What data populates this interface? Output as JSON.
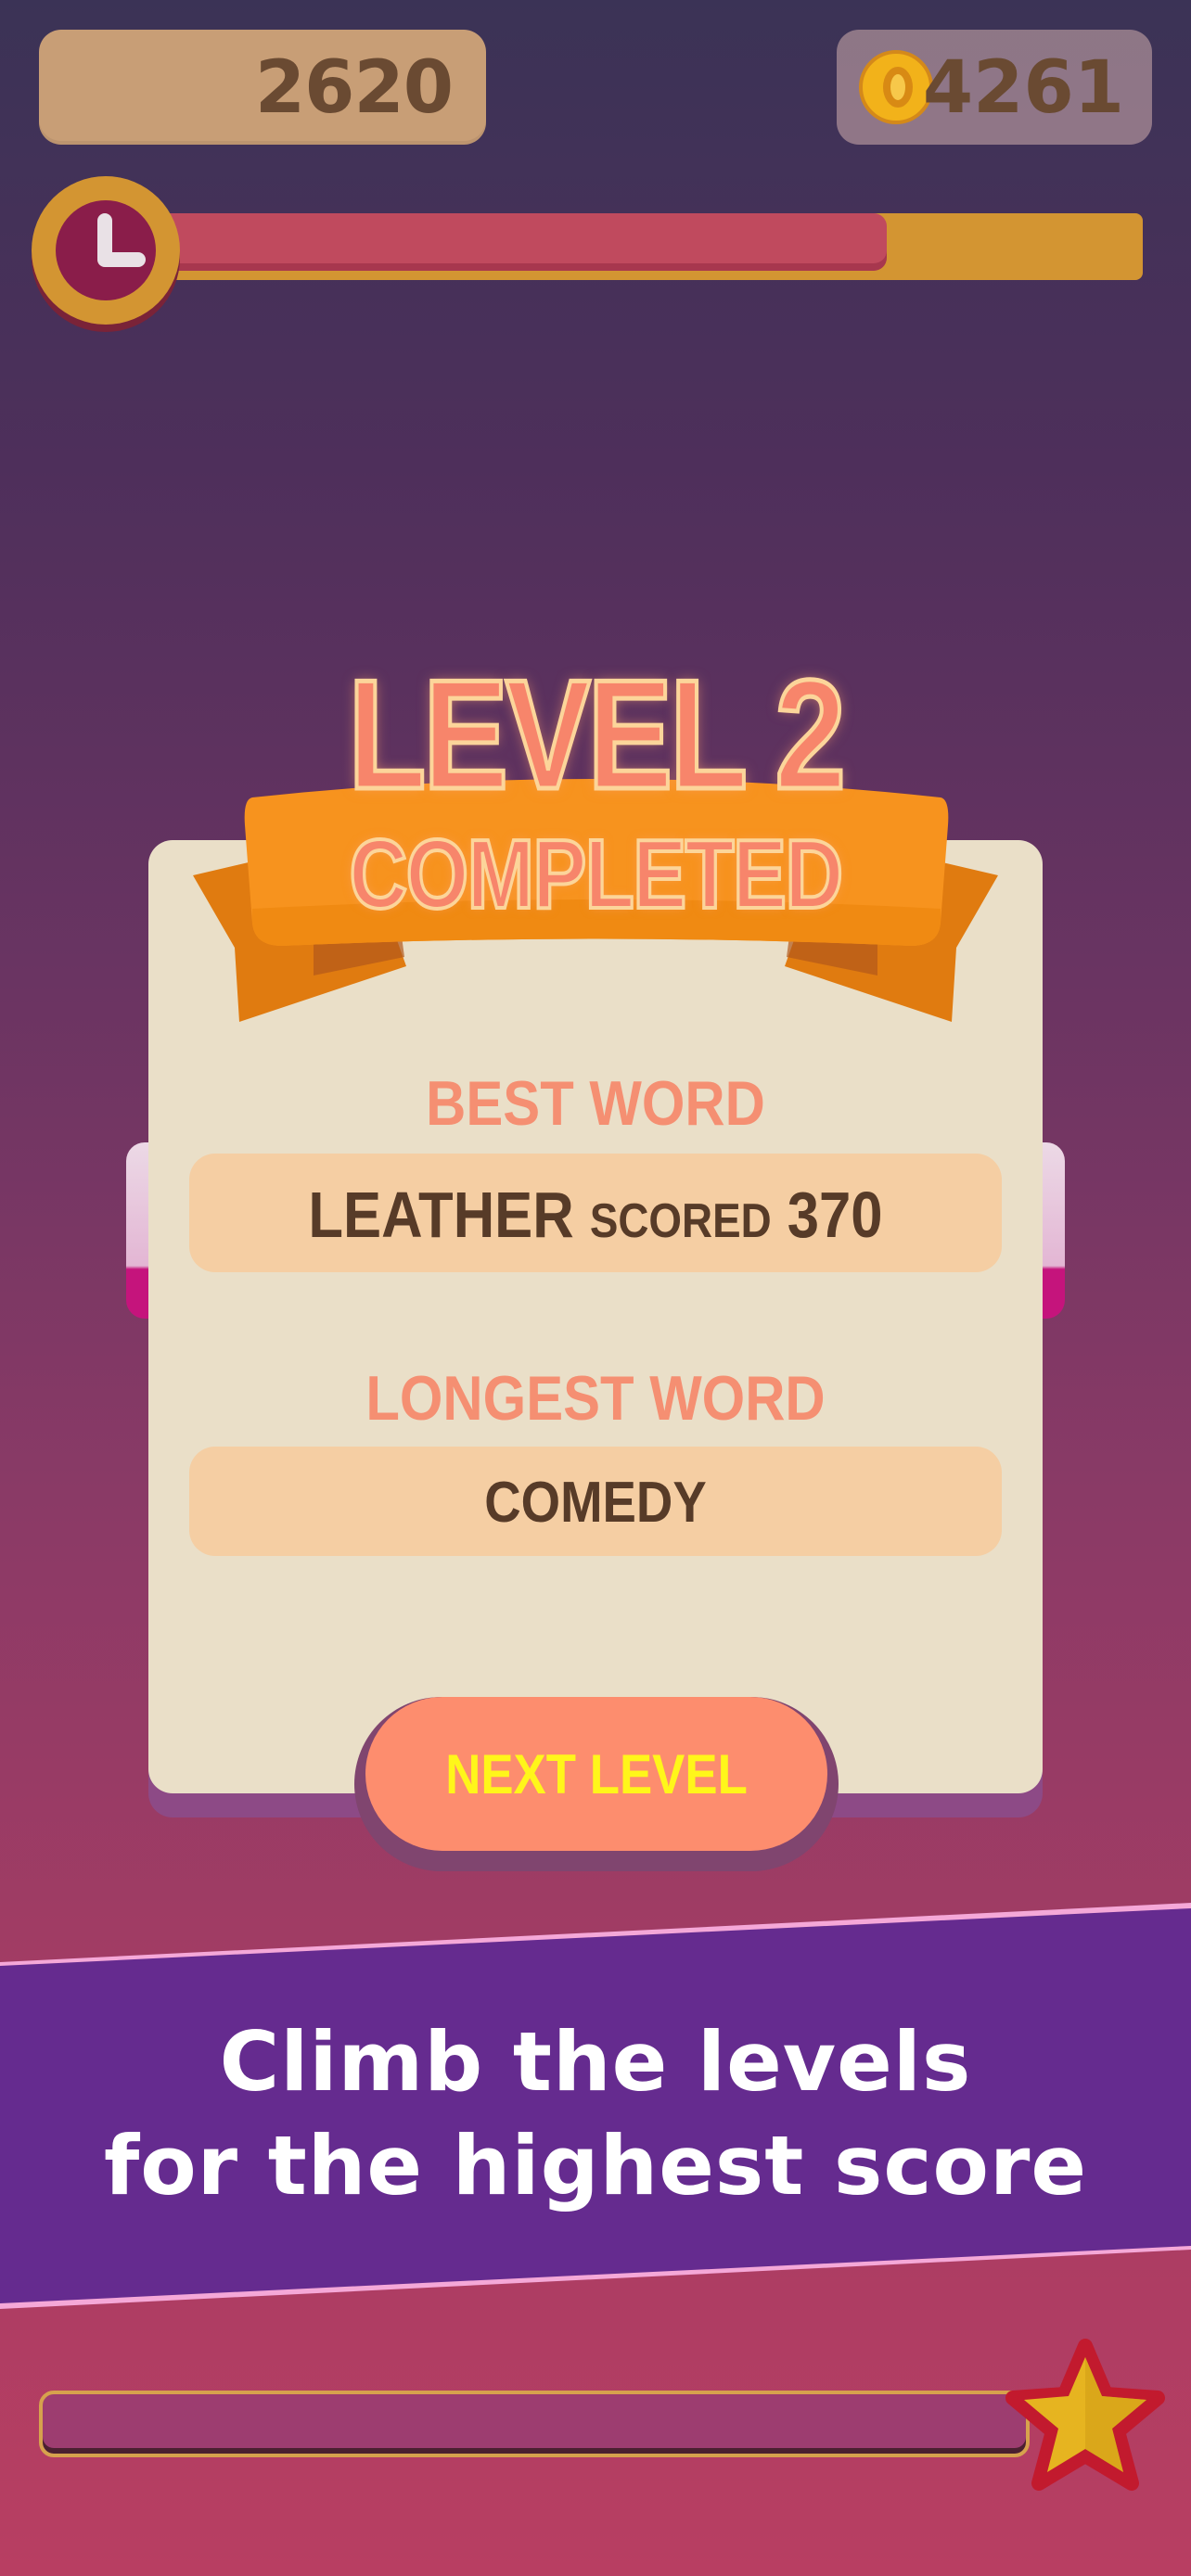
{
  "hud": {
    "score": "2620",
    "coins": "4261",
    "timer_fraction": 0.74,
    "coin_icon": "coin-icon",
    "clock_icon": "clock-icon"
  },
  "dialog": {
    "title_line1": "LEVEL 2",
    "title_line2": "COMPLETED",
    "best_word_label": "BEST WORD",
    "best_word": "LEATHER",
    "best_word_scored": "SCORED",
    "best_word_score": "370",
    "longest_word_label": "LONGEST WORD",
    "longest_word": "COMEDY",
    "next_button": "NEXT LEVEL"
  },
  "banner": {
    "line1": "Climb the levels",
    "line2": "for the highest score"
  },
  "footer": {
    "progress_fraction": 0.0,
    "star_icon": "star-icon"
  },
  "colors": {
    "accent_orange": "#f7931e",
    "title_coral": "#f7856b",
    "button_coral": "#fd8d6e",
    "button_text": "#fff61a",
    "banner_purple": "#652b8f"
  }
}
